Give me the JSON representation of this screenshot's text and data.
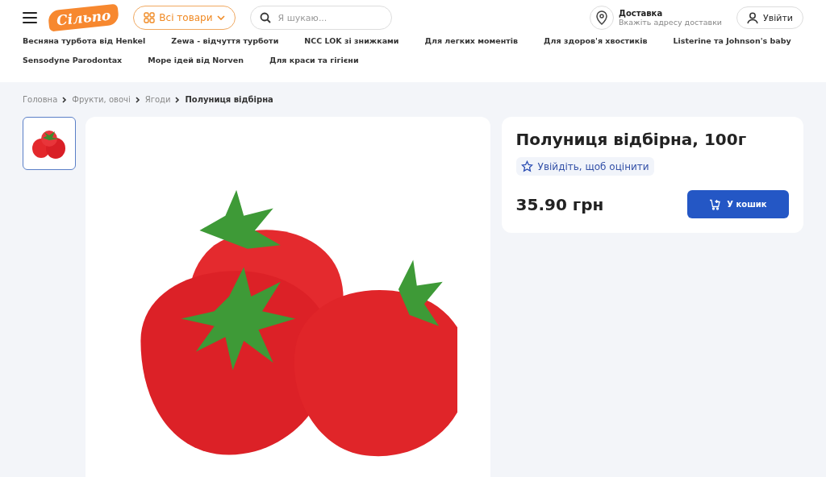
{
  "header": {
    "logo": "Сільпо",
    "catalog_button": "Всі товари",
    "search": {
      "placeholder": "Я шукаю..."
    },
    "delivery": {
      "title": "Доставка",
      "subtitle": "Вкажіть адресу доставки"
    },
    "login_button": "Увійти"
  },
  "promo_links": [
    {
      "label": "Весняна турбота від Henkel"
    },
    {
      "label": "Zewa - відчуття турботи"
    },
    {
      "label": "NCC LOK зі знижками"
    },
    {
      "label": "Для легких моментів"
    },
    {
      "label": "Для здоров'я хвостиків"
    },
    {
      "label": "Listerine та Johnson's baby"
    },
    {
      "label": "Sensodyne Parodontax"
    },
    {
      "label": "Море ідей від Norven"
    },
    {
      "label": "Для краси та гігієни"
    }
  ],
  "breadcrumbs": [
    {
      "label": "Головна",
      "current": false
    },
    {
      "label": "Фрукти, овочі",
      "current": false
    },
    {
      "label": "Ягоди",
      "current": false
    },
    {
      "label": "Полуниця відбірна",
      "current": true
    }
  ],
  "gallery": {
    "thumbnails": [
      {
        "selected": true
      }
    ]
  },
  "product": {
    "title": "Полуниця відбірна, 100г",
    "rating_prompt": "Увійдіть, щоб оцінити",
    "price": "35.90 грн",
    "cart_button": "У кошик"
  }
}
